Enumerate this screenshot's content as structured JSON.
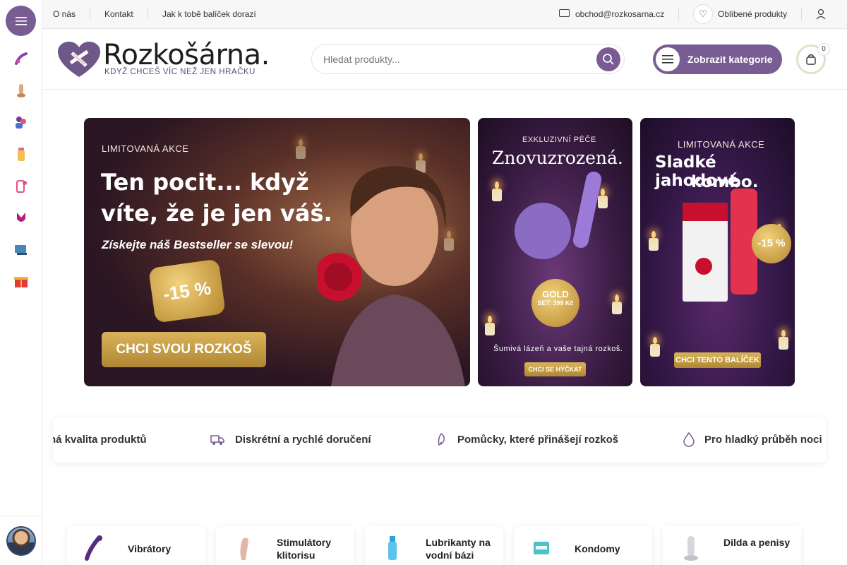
{
  "topbar": {
    "links": [
      "O nás",
      "Kontakt",
      "Jak k tobě balíček dorazí"
    ],
    "email": "obchod@rozkosarna.cz",
    "favorites_label": "Oblíbené produkty"
  },
  "header": {
    "brand": "Rozkošárna.",
    "tagline": "KDYŽ CHCEŠ VÍC NEŽ JEN HRAČKU",
    "search_placeholder": "Hledat produkty...",
    "categories_button": "Zobrazit kategorie",
    "cart_count": "0"
  },
  "rail": {
    "icons": [
      "vibrator-icon",
      "dildo-icon",
      "couple-icon",
      "lubricant-icon",
      "cosmetics-icon",
      "lingerie-icon",
      "bdsm-icon",
      "gift-icon"
    ]
  },
  "banners": {
    "main": {
      "kicker": "LIMITOVANÁ AKCE",
      "headline_1": "Ten pocit... když",
      "headline_2": "víte, že je jen váš.",
      "subline": "Získejte náš Bestseller se slevou!",
      "discount": "-15 %",
      "cta": "CHCI SVOU ROZKOŠ"
    },
    "middle": {
      "kicker": "EXKLUZIVNÍ PÉČE",
      "headline": "Znovuzrozená.",
      "badge_title": "GOLD",
      "badge_price": "SET: 399 Kč",
      "footer": "Šumivá lázeň a vaše tajná rozkoš.",
      "cta": "CHCI SE HÝČKAT"
    },
    "right": {
      "kicker": "LIMITOVANÁ AKCE",
      "headline_1": "Sladké jahodové",
      "headline_2": "kombo.",
      "discount": "-15 %",
      "cta": "CHCI TENTO BALÍČEK"
    }
  },
  "features": [
    "ná kvalita produktů",
    "Diskrétní a rychlé doručení",
    "Pomůcky, které přinášejí rozkoš",
    "Pro hladký průběh noci"
  ],
  "categories": [
    "Vibrátory",
    "Stimulátory klitorisu",
    "Lubrikanty na vodní bázi",
    "Kondomy",
    "Dilda a penisy"
  ],
  "colors": {
    "brand_purple": "#7a5c94",
    "gold": "#c79a3e"
  }
}
